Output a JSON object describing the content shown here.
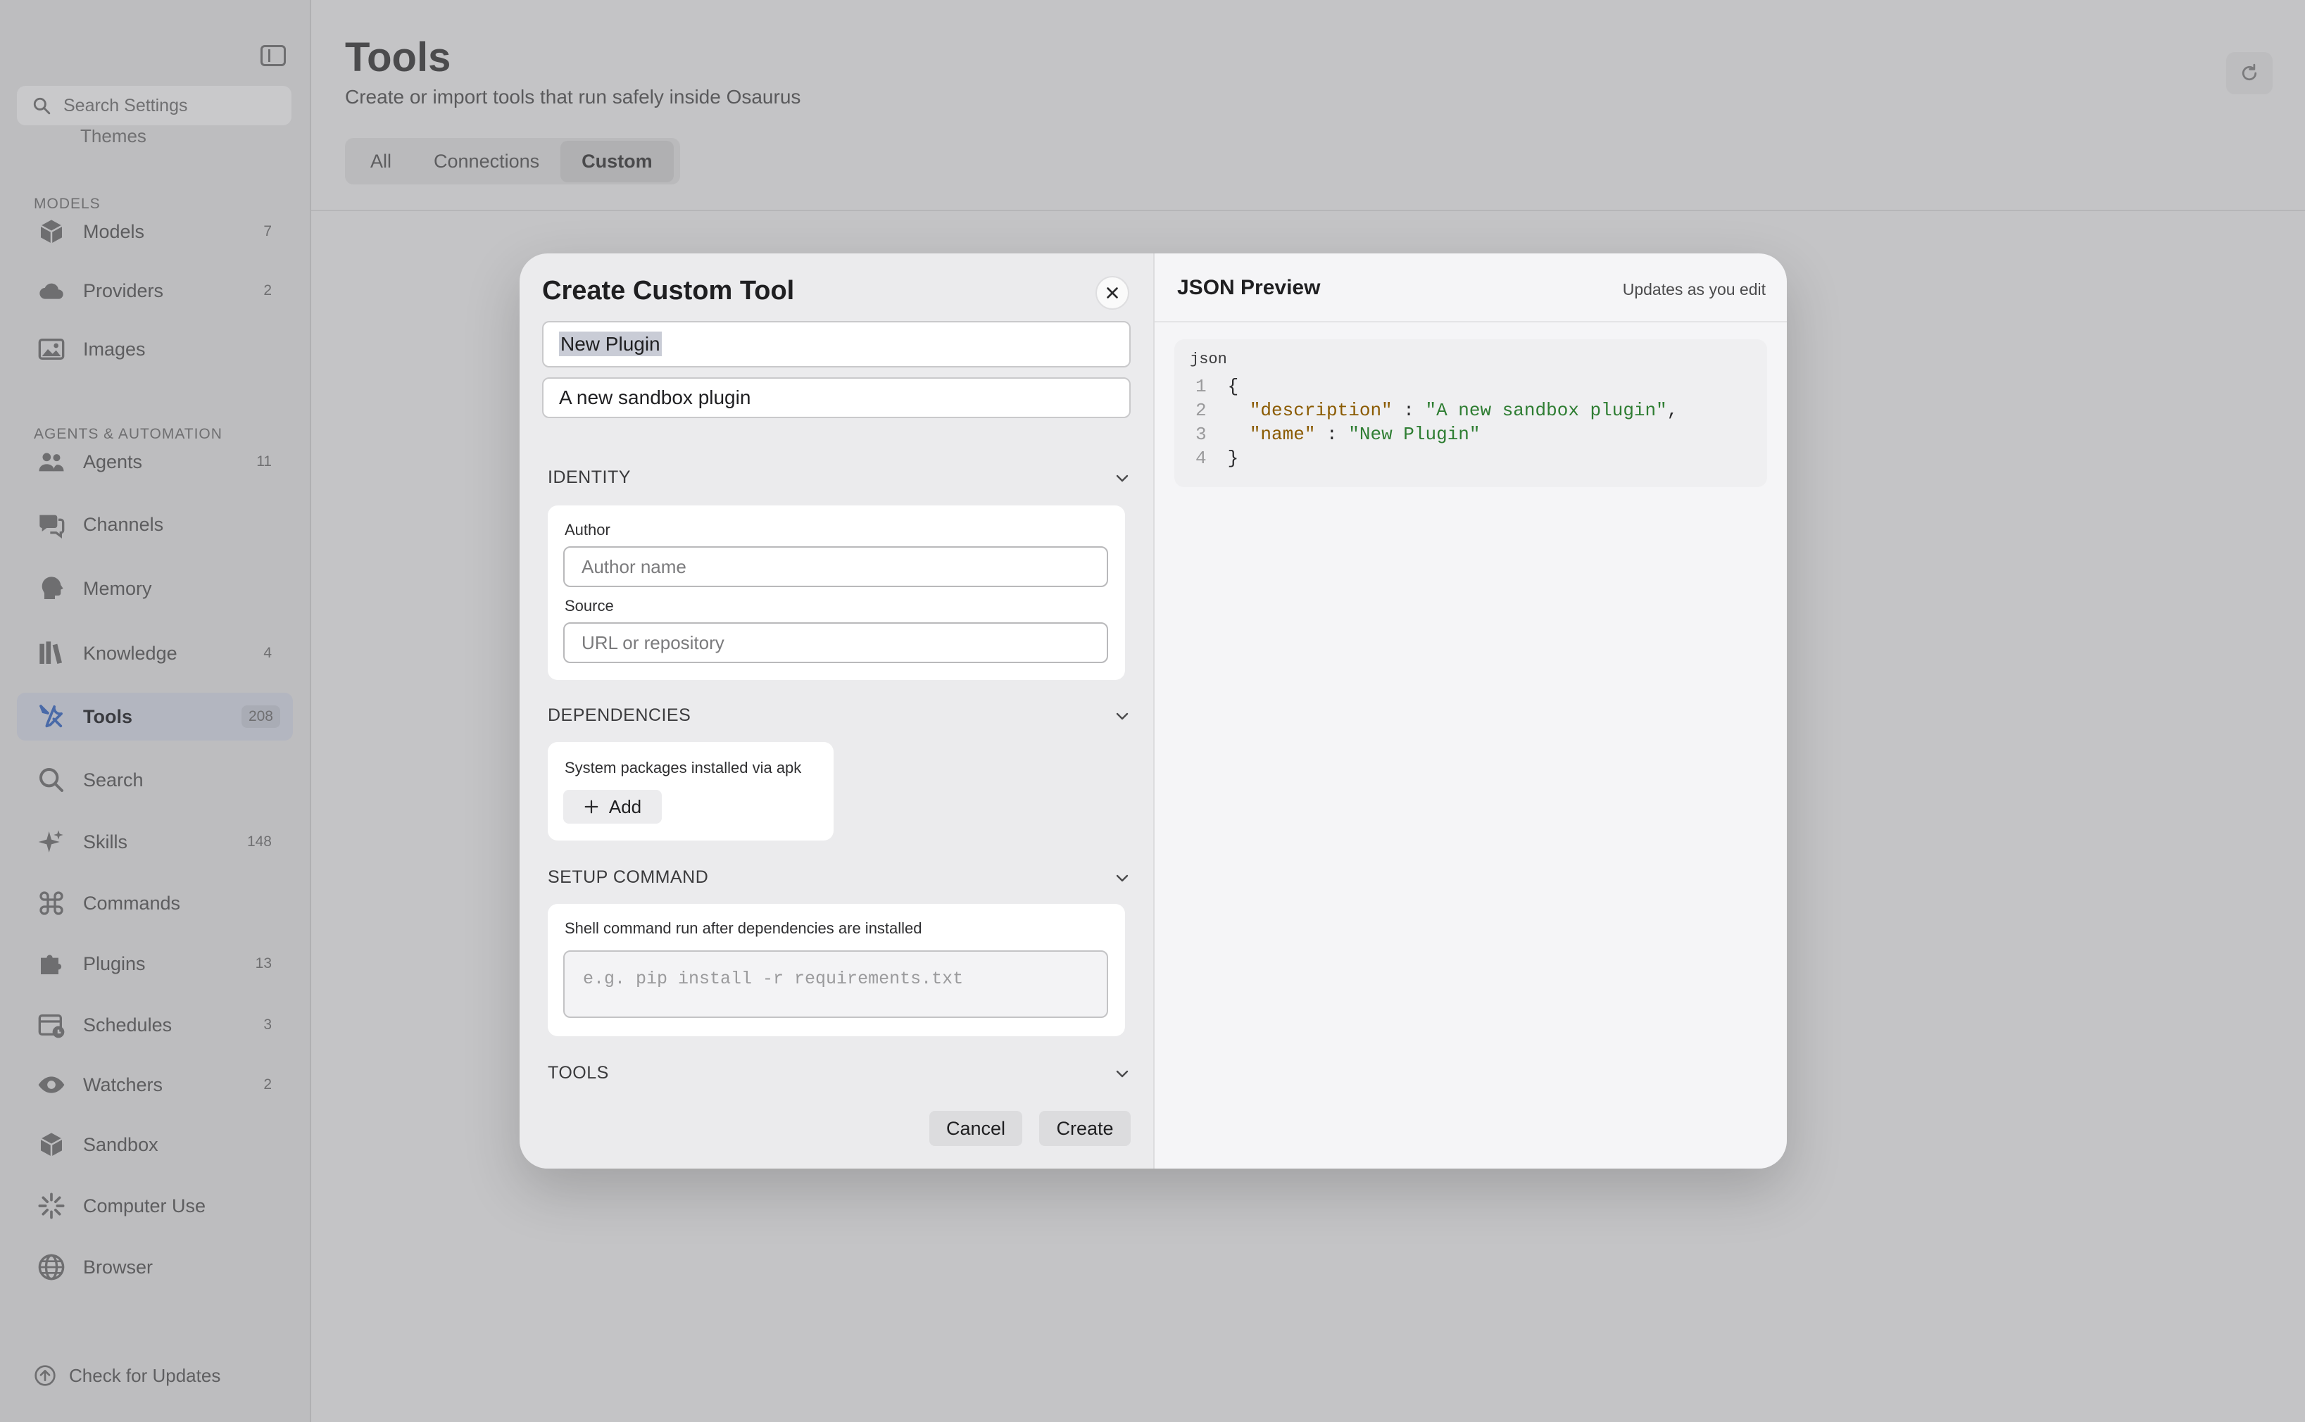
{
  "sidebar": {
    "search_placeholder": "Search Settings",
    "partial_item": "Themes",
    "sections": {
      "models": "MODELS",
      "agents": "AGENTS & AUTOMATION"
    },
    "items": [
      {
        "label": "Models",
        "count": "7",
        "icon": "cube-icon"
      },
      {
        "label": "Providers",
        "count": "2",
        "icon": "cloud-icon"
      },
      {
        "label": "Images",
        "count": "",
        "icon": "photo-icon"
      },
      {
        "label": "Agents",
        "count": "11",
        "icon": "people-icon"
      },
      {
        "label": "Channels",
        "count": "",
        "icon": "chat-bubbles-icon"
      },
      {
        "label": "Memory",
        "count": "",
        "icon": "brain-head-icon"
      },
      {
        "label": "Knowledge",
        "count": "4",
        "icon": "books-icon"
      },
      {
        "label": "Tools",
        "count": "208",
        "icon": "tools-icon"
      },
      {
        "label": "Search",
        "count": "",
        "icon": "magnifier-icon"
      },
      {
        "label": "Skills",
        "count": "148",
        "icon": "sparkles-icon"
      },
      {
        "label": "Commands",
        "count": "",
        "icon": "command-icon"
      },
      {
        "label": "Plugins",
        "count": "13",
        "icon": "puzzle-icon"
      },
      {
        "label": "Schedules",
        "count": "3",
        "icon": "calendar-icon"
      },
      {
        "label": "Watchers",
        "count": "2",
        "icon": "eye-icon"
      },
      {
        "label": "Sandbox",
        "count": "",
        "icon": "box-icon"
      },
      {
        "label": "Computer Use",
        "count": "",
        "icon": "cursor-burst-icon"
      },
      {
        "label": "Browser",
        "count": "",
        "icon": "globe-icon"
      }
    ],
    "check_updates": "Check for Updates"
  },
  "header": {
    "title": "Tools",
    "subtitle": "Create or import tools that run safely inside Osaurus",
    "tabs": [
      "All",
      "Connections",
      "Custom"
    ],
    "active_tab": "Custom"
  },
  "modal": {
    "title": "Create Custom Tool",
    "name_value": "New Plugin",
    "description_value": "A new sandbox plugin",
    "identity": {
      "heading": "IDENTITY",
      "author_label": "Author",
      "author_placeholder": "Author name",
      "source_label": "Source",
      "source_placeholder": "URL or repository"
    },
    "dependencies": {
      "heading": "DEPENDENCIES",
      "note": "System packages installed via apk",
      "add_label": "Add"
    },
    "setup": {
      "heading": "SETUP COMMAND",
      "note": "Shell command run after dependencies are installed",
      "placeholder": "e.g. pip install -r requirements.txt"
    },
    "tools_heading": "TOOLS",
    "cancel_label": "Cancel",
    "create_label": "Create"
  },
  "preview": {
    "title": "JSON Preview",
    "note": "Updates as you edit",
    "lang": "json",
    "lines": [
      {
        "n": "1",
        "open": "{"
      },
      {
        "n": "2",
        "key": "\"description\"",
        "value": "\"A new sandbox plugin\"",
        "trail": ","
      },
      {
        "n": "3",
        "key": "\"name\"",
        "value": "\"New Plugin\"",
        "trail": ""
      },
      {
        "n": "4",
        "close": "}"
      }
    ]
  },
  "colors": {
    "json_key": "#8a5a00",
    "json_string": "#2e7d32",
    "active_nav": "#b3b6c0"
  }
}
